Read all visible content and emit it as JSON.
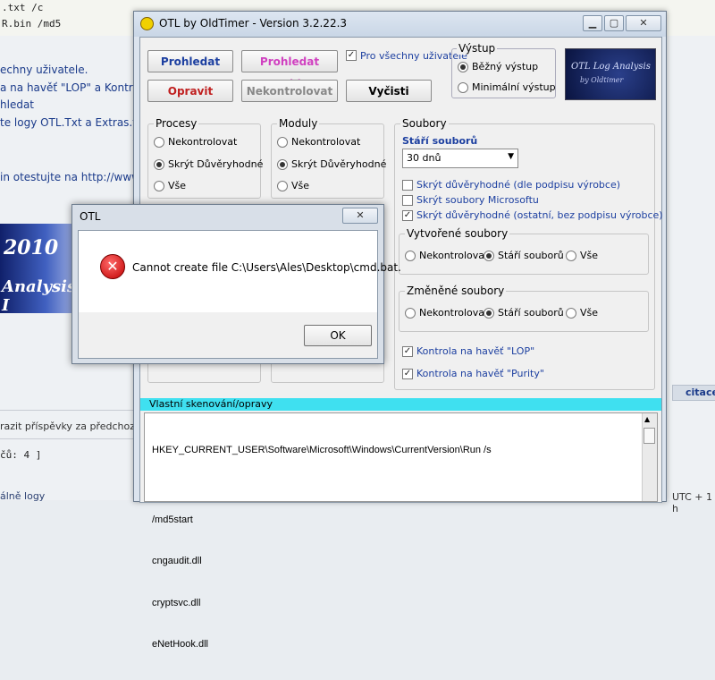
{
  "background": {
    "code_lines": [
      ".txt /c",
      "R.bin /md5"
    ],
    "forum_lines": [
      "echny uživatele.",
      "a na havěť \"LOP\" a Kontrola",
      "hledat",
      "te logy OTL.Txt a Extras.txt",
      "in otestujte na http://www.",
      "razit příspěvky za předchozí:",
      "čů: 4 ]",
      "citace",
      "UTC + 1 h",
      "álně logy"
    ],
    "banner_text": [
      "2010",
      "Analysis I"
    ]
  },
  "otl": {
    "title": "OTL by OldTimer - Version 3.2.22.3",
    "buttons": {
      "prohledat": "Prohledat",
      "prohledat_rychle": "Prohledat rychle",
      "opravit": "Opravit",
      "nekontrolovat": "Nekontrolovat",
      "vycisti": "Vyčisti"
    },
    "all_users_label": "Pro všechny uživatele",
    "vystup": {
      "label": "Výstup",
      "options": [
        "Běžný výstup",
        "Minimální výstup"
      ],
      "selected": "Běžný výstup"
    },
    "logo": {
      "line1": "OTL Log Analysis",
      "line2": "by Oldtimer"
    },
    "procesy": {
      "label": "Procesy",
      "options": [
        "Nekontrolovat",
        "Skrýt Důvěryhodné",
        "Vše"
      ],
      "selected": "Skrýt Důvěryhodné"
    },
    "moduly": {
      "label": "Moduly",
      "options": [
        "Nekontrolovat",
        "Skrýt Důvěryhodné",
        "Vše"
      ],
      "selected": "Skrýt Důvěryhodné"
    },
    "soubory": {
      "label": "Soubory",
      "stari_label": "Stáří souborů",
      "stari_value": "30 dnů",
      "checks": [
        {
          "label": "Skrýt důvěryhodné (dle podpisu výrobce)",
          "checked": false
        },
        {
          "label": "Skrýt soubory Microsoftu",
          "checked": false
        },
        {
          "label": "Skrýt důvěryhodné (ostatní, bez podpisu výrobce)",
          "checked": true
        }
      ],
      "vytvorene": {
        "label": "Vytvořené soubory",
        "options": [
          "Nekontrolovat",
          "Stáří souborů",
          "Vše"
        ],
        "selected": "Stáří souborů"
      },
      "zmenene": {
        "label": "Změněné soubory",
        "options": [
          "Nekontrolovat",
          "Stáří souborů",
          "Vše"
        ],
        "selected": "Stáří souborů"
      },
      "lop_label": "Kontrola na havěť \"LOP\"",
      "purity_label": "Kontrola na havěť \"Purity\""
    },
    "custom_scan": {
      "label": "Vlastní skenování/opravy",
      "lines": [
        "HKEY_CURRENT_USER\\Software\\Microsoft\\Windows\\CurrentVersion\\Run /s",
        "",
        "/md5start",
        "cngaudit.dll",
        "cryptsvc.dll",
        "eNetHook.dll"
      ]
    }
  },
  "error_dialog": {
    "title": "OTL",
    "message": "Cannot create file C:\\Users\\Ales\\Desktop\\cmd.bat.",
    "ok_label": "OK"
  }
}
